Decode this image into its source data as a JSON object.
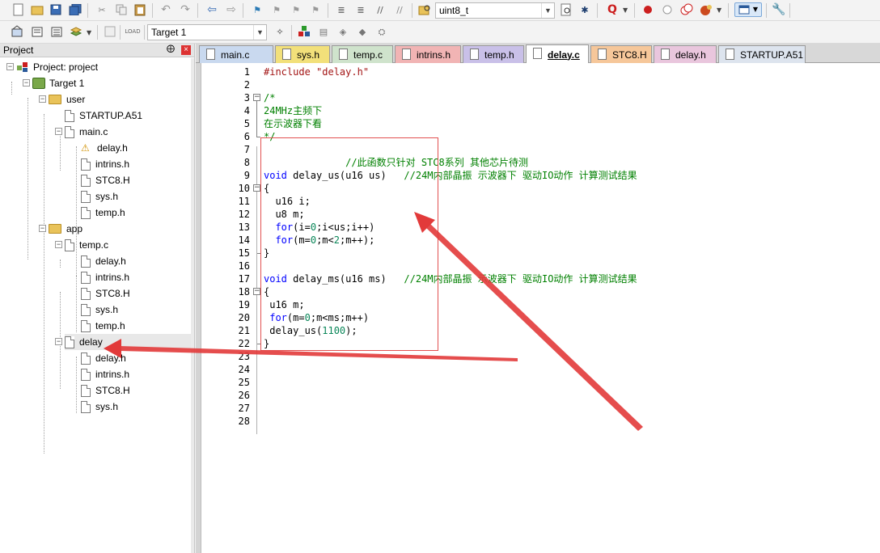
{
  "toolbar1": {
    "combo_value": "uint8_t"
  },
  "toolbar2": {
    "target_value": "Target 1"
  },
  "project_panel": {
    "title": "Project",
    "pin_glyph": "⨁",
    "close_glyph": "×",
    "tree": [
      {
        "label": "Project: project",
        "icon": "project-icon"
      },
      {
        "label": "Target 1",
        "icon": "target-icon"
      },
      {
        "label": "user",
        "icon": "folder-icon"
      },
      {
        "label": "STARTUP.A51",
        "icon": "file-icon"
      },
      {
        "label": "main.c",
        "icon": "file-icon"
      },
      {
        "label": "delay.h",
        "icon": "warning-file-icon"
      },
      {
        "label": "intrins.h",
        "icon": "file-icon"
      },
      {
        "label": "STC8.H",
        "icon": "file-icon"
      },
      {
        "label": "sys.h",
        "icon": "file-icon"
      },
      {
        "label": "temp.h",
        "icon": "file-icon"
      },
      {
        "label": "app",
        "icon": "folder-icon"
      },
      {
        "label": "temp.c",
        "icon": "file-icon"
      },
      {
        "label": "delay.h",
        "icon": "file-icon"
      },
      {
        "label": "intrins.h",
        "icon": "file-icon"
      },
      {
        "label": "STC8.H",
        "icon": "file-icon"
      },
      {
        "label": "sys.h",
        "icon": "file-icon"
      },
      {
        "label": "temp.h",
        "icon": "file-icon"
      },
      {
        "label": "delay",
        "icon": "file-icon"
      },
      {
        "label": "delay.h",
        "icon": "file-icon"
      },
      {
        "label": "intrins.h",
        "icon": "file-icon"
      },
      {
        "label": "STC8.H",
        "icon": "file-icon"
      },
      {
        "label": "sys.h",
        "icon": "file-icon"
      }
    ]
  },
  "tabs": [
    {
      "label": "main.c",
      "color": "#c9d9ef"
    },
    {
      "label": "sys.h",
      "color": "#f2e07a"
    },
    {
      "label": "temp.c",
      "color": "#cfe3cc"
    },
    {
      "label": "intrins.h",
      "color": "#f1b4b4"
    },
    {
      "label": "temp.h",
      "color": "#c9c0e8"
    },
    {
      "label": "delay.c",
      "color": "#ffffff"
    },
    {
      "label": "STC8.H",
      "color": "#f6c79a"
    },
    {
      "label": "delay.h",
      "color": "#e9c6dd"
    },
    {
      "label": "STARTUP.A51",
      "color": "#dde4ee"
    }
  ],
  "editor": {
    "line_numbers": [
      "1",
      "2",
      "3",
      "4",
      "5",
      "6",
      "7",
      "8",
      "9",
      "10",
      "11",
      "12",
      "13",
      "14",
      "15",
      "16",
      "17",
      "18",
      "19",
      "20",
      "21",
      "22",
      "23",
      "24",
      "25",
      "26",
      "27",
      "28"
    ],
    "lines": [
      {
        "parts": [
          {
            "t": "#include \"delay.h\"",
            "c": "str"
          }
        ]
      },
      {
        "parts": []
      },
      {
        "parts": [
          {
            "t": "/*",
            "c": "cm"
          }
        ]
      },
      {
        "parts": [
          {
            "t": "24MHz主频下",
            "c": "cm"
          }
        ]
      },
      {
        "parts": [
          {
            "t": "在示波器下看",
            "c": "cm"
          }
        ]
      },
      {
        "parts": [
          {
            "t": "*/",
            "c": "cm"
          }
        ]
      },
      {
        "parts": []
      },
      {
        "parts": [
          {
            "t": "              //此函数只针对 STC8系列 其他芯片待测",
            "c": "cm"
          }
        ]
      },
      {
        "parts": [
          {
            "t": "void",
            "c": "kw"
          },
          {
            "t": " delay_us(u16 us)   ",
            "c": ""
          },
          {
            "t": "//24M内部晶振 示波器下 驱动IO动作 计算测试结果",
            "c": "cm"
          }
        ]
      },
      {
        "parts": [
          {
            "t": "{",
            "c": ""
          }
        ]
      },
      {
        "parts": [
          {
            "t": "  u16 i;",
            "c": ""
          }
        ]
      },
      {
        "parts": [
          {
            "t": "  u8 m;",
            "c": ""
          }
        ]
      },
      {
        "parts": [
          {
            "t": "  ",
            "c": ""
          },
          {
            "t": "for",
            "c": "kw"
          },
          {
            "t": "(i=",
            "c": ""
          },
          {
            "t": "0",
            "c": "num"
          },
          {
            "t": ";i<us;i++)",
            "c": ""
          }
        ]
      },
      {
        "parts": [
          {
            "t": "  ",
            "c": ""
          },
          {
            "t": "for",
            "c": "kw"
          },
          {
            "t": "(m=",
            "c": ""
          },
          {
            "t": "0",
            "c": "num"
          },
          {
            "t": ";m<",
            "c": ""
          },
          {
            "t": "2",
            "c": "num"
          },
          {
            "t": ";m++);",
            "c": ""
          }
        ]
      },
      {
        "parts": [
          {
            "t": "}",
            "c": ""
          }
        ]
      },
      {
        "parts": []
      },
      {
        "parts": [
          {
            "t": "void",
            "c": "kw"
          },
          {
            "t": " delay_ms(u16 ms)   ",
            "c": ""
          },
          {
            "t": "//24M内部晶振 示波器下 驱动IO动作 计算测试结果",
            "c": "cm"
          }
        ]
      },
      {
        "parts": [
          {
            "t": "{",
            "c": ""
          }
        ]
      },
      {
        "parts": [
          {
            "t": " u16 m;",
            "c": ""
          }
        ]
      },
      {
        "parts": [
          {
            "t": " ",
            "c": ""
          },
          {
            "t": "for",
            "c": "kw"
          },
          {
            "t": "(m=",
            "c": ""
          },
          {
            "t": "0",
            "c": "num"
          },
          {
            "t": ";m<ms;m++)",
            "c": ""
          }
        ]
      },
      {
        "parts": [
          {
            "t": " delay_us(",
            "c": ""
          },
          {
            "t": "1100",
            "c": "num"
          },
          {
            "t": ");",
            "c": ""
          }
        ]
      },
      {
        "parts": [
          {
            "t": "}",
            "c": ""
          }
        ]
      },
      {
        "parts": []
      },
      {
        "parts": []
      },
      {
        "parts": []
      },
      {
        "parts": []
      },
      {
        "parts": []
      },
      {
        "parts": []
      }
    ]
  },
  "colors": {
    "annotation": "#e23a3a",
    "comment": "#008000",
    "keyword": "#0000ff"
  }
}
